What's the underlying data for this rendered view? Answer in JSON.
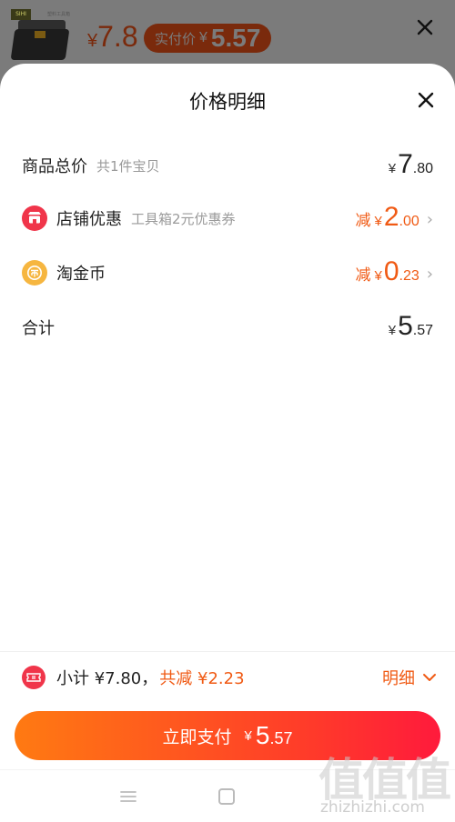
{
  "product_strip": {
    "thumb_tag": "SIHI",
    "thumb_caption": "塑料工具箱",
    "original_price_symbol": "¥",
    "original_price": "7.8",
    "real_price_label": "实付价",
    "real_price_symbol": "¥",
    "real_price": "5.57"
  },
  "sheet": {
    "title": "价格明细"
  },
  "rows": {
    "total": {
      "label": "商品总价",
      "sub": "共1件宝贝",
      "symbol": "¥",
      "int": "7",
      "dec": ".80"
    },
    "shop_discount": {
      "label": "店铺优惠",
      "sub": "工具箱2元优惠券",
      "prefix": "减",
      "symbol": "¥",
      "int": "2",
      "dec": ".00",
      "icon": "shop-icon"
    },
    "taojinbi": {
      "label": "淘金币",
      "prefix": "减",
      "symbol": "¥",
      "int": "0",
      "dec": ".23",
      "icon": "coin-icon"
    },
    "sum": {
      "label": "合计",
      "symbol": "¥",
      "int": "5",
      "dec": ".57"
    }
  },
  "footer": {
    "subtotal_text": "小计 ¥7.80，",
    "reduce_text": "共减 ¥2.23",
    "detail_label": "明细",
    "pay_label": "立即支付",
    "pay_symbol": "¥",
    "pay_int": "5",
    "pay_dec": ".57"
  },
  "watermark": {
    "chars": "值值值",
    "url": "zhizhizhi.com"
  },
  "colors": {
    "accent_orange": "#f05a14",
    "shop_red": "#f0354a",
    "coin_gold": "#f6b640",
    "pay_gradient_start": "#ff7a12",
    "pay_gradient_end": "#ff1a3c"
  }
}
